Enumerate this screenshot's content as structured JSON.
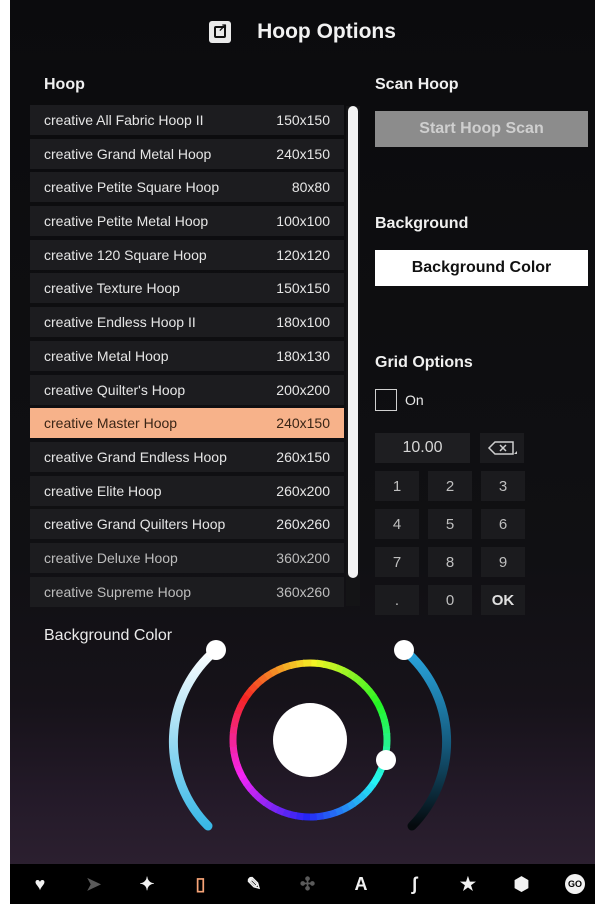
{
  "title": "Hoop Options",
  "hoop_section": "Hoop",
  "hoops": [
    {
      "name": "creative All Fabric Hoop II",
      "size": "150x150"
    },
    {
      "name": "creative Grand Metal Hoop",
      "size": "240x150"
    },
    {
      "name": "creative Petite Square Hoop",
      "size": "80x80"
    },
    {
      "name": "creative Petite Metal Hoop",
      "size": "100x100"
    },
    {
      "name": "creative 120 Square Hoop",
      "size": "120x120"
    },
    {
      "name": "creative Texture Hoop",
      "size": "150x150"
    },
    {
      "name": "creative Endless Hoop II",
      "size": "180x100"
    },
    {
      "name": "creative Metal Hoop",
      "size": "180x130"
    },
    {
      "name": "creative Quilter's Hoop",
      "size": "200x200"
    },
    {
      "name": "creative Master Hoop",
      "size": "240x150"
    },
    {
      "name": "creative Grand Endless Hoop",
      "size": "260x150"
    },
    {
      "name": "creative Elite Hoop",
      "size": "260x200"
    },
    {
      "name": "creative Grand Quilters Hoop",
      "size": "260x260"
    },
    {
      "name": "creative Deluxe Hoop",
      "size": "360x200"
    },
    {
      "name": "creative Supreme Hoop",
      "size": "360x260"
    }
  ],
  "selected_hoop": "creative Master Hoop",
  "scan_section": "Scan Hoop",
  "scan_button": "Start Hoop Scan",
  "background_section": "Background",
  "background_button": "Background Color",
  "grid_section": "Grid Options",
  "grid_on_label": "On",
  "grid_value": "10.00",
  "keypad": [
    "1",
    "2",
    "3",
    "4",
    "5",
    "6",
    "7",
    "8",
    "9",
    ".",
    "0",
    "OK"
  ],
  "background_color_label": "Background Color",
  "colors": {
    "selected_row": "#f7b28a",
    "accent": "#f7a477"
  },
  "bottom_icons": [
    "heart-icon",
    "send-icon",
    "puzzle-icon",
    "hoop-icon",
    "sew-icon",
    "stitch-icon",
    "font-icon",
    "thread-icon",
    "star-icon",
    "settings-icon",
    "go-icon"
  ],
  "go_label": "GO"
}
